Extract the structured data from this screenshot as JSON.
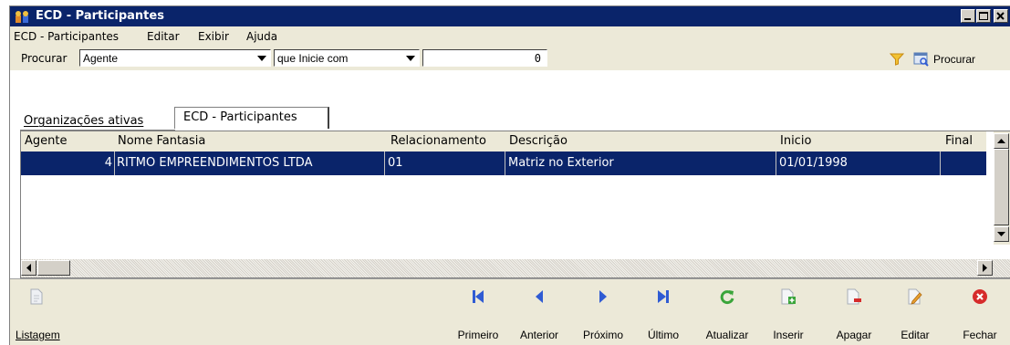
{
  "window": {
    "title": "ECD - Participantes"
  },
  "menu": [
    {
      "label": "ECD - Participantes"
    },
    {
      "label": "Editar"
    },
    {
      "label": "Exibir"
    },
    {
      "label": "Ajuda"
    }
  ],
  "search": {
    "label": "Procurar",
    "field": "Agente",
    "mode": "que Inicie com",
    "value": "0",
    "button_label": "Procurar"
  },
  "tabs": [
    {
      "label": "Organizações ativas",
      "active": false
    },
    {
      "label": "ECD - Participantes",
      "active": true
    }
  ],
  "grid": {
    "columns": [
      "Agente",
      "Nome Fantasia",
      "Relacionamento",
      "Descrição",
      "Inicio",
      "Final"
    ],
    "rows": [
      {
        "agente": "4",
        "nome": "RITMO EMPREENDIMENTOS LTDA",
        "relacionamento": "01",
        "descricao": "Matriz no Exterior",
        "inicio": "01/01/1998",
        "final": ""
      }
    ]
  },
  "toolbar": {
    "listagem": "Listagem",
    "primeiro": "Primeiro",
    "anterior": "Anterior",
    "proximo": "Próximo",
    "ultimo": "Último",
    "atualizar": "Atualizar",
    "inserir": "Inserir",
    "apagar": "Apagar",
    "editar": "Editar",
    "fechar": "Fechar"
  },
  "colors": {
    "titlebar": "#0a246a",
    "selection": "#0a246a",
    "nav_blue": "#2f5bd3",
    "refresh_green": "#3aa53a",
    "close_red": "#d62b2b"
  }
}
